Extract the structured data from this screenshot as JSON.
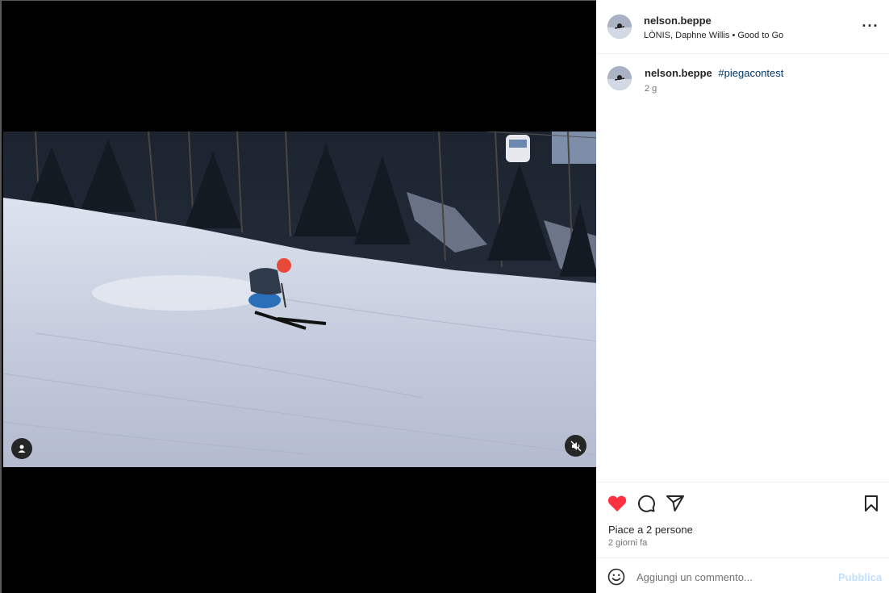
{
  "post": {
    "author": "nelson.beppe",
    "music": {
      "artists": "LÒNIS, Daphne Willis",
      "separator": "•",
      "track": "Good to Go"
    },
    "more_label": "···",
    "caption": {
      "author": "nelson.beppe",
      "hashtag": "#piegacontest",
      "time": "2 g"
    },
    "likes_text": "Piace a 2 persone",
    "time_ago": "2 giorni fa",
    "liked": true
  },
  "comment": {
    "placeholder": "Aggiungi un commento...",
    "publish_label": "Pubblica"
  },
  "colors": {
    "like_red": "#ff3040",
    "link_blue": "#00376b",
    "publish_disabled": "#c0dffd"
  },
  "icons": {
    "tag": "user-tag-icon",
    "mute": "speaker-muted-icon",
    "like": "heart-icon",
    "comment": "speech-bubble-icon",
    "share": "paper-plane-icon",
    "save": "bookmark-icon",
    "emoji": "smiley-icon",
    "more": "ellipsis-icon"
  }
}
